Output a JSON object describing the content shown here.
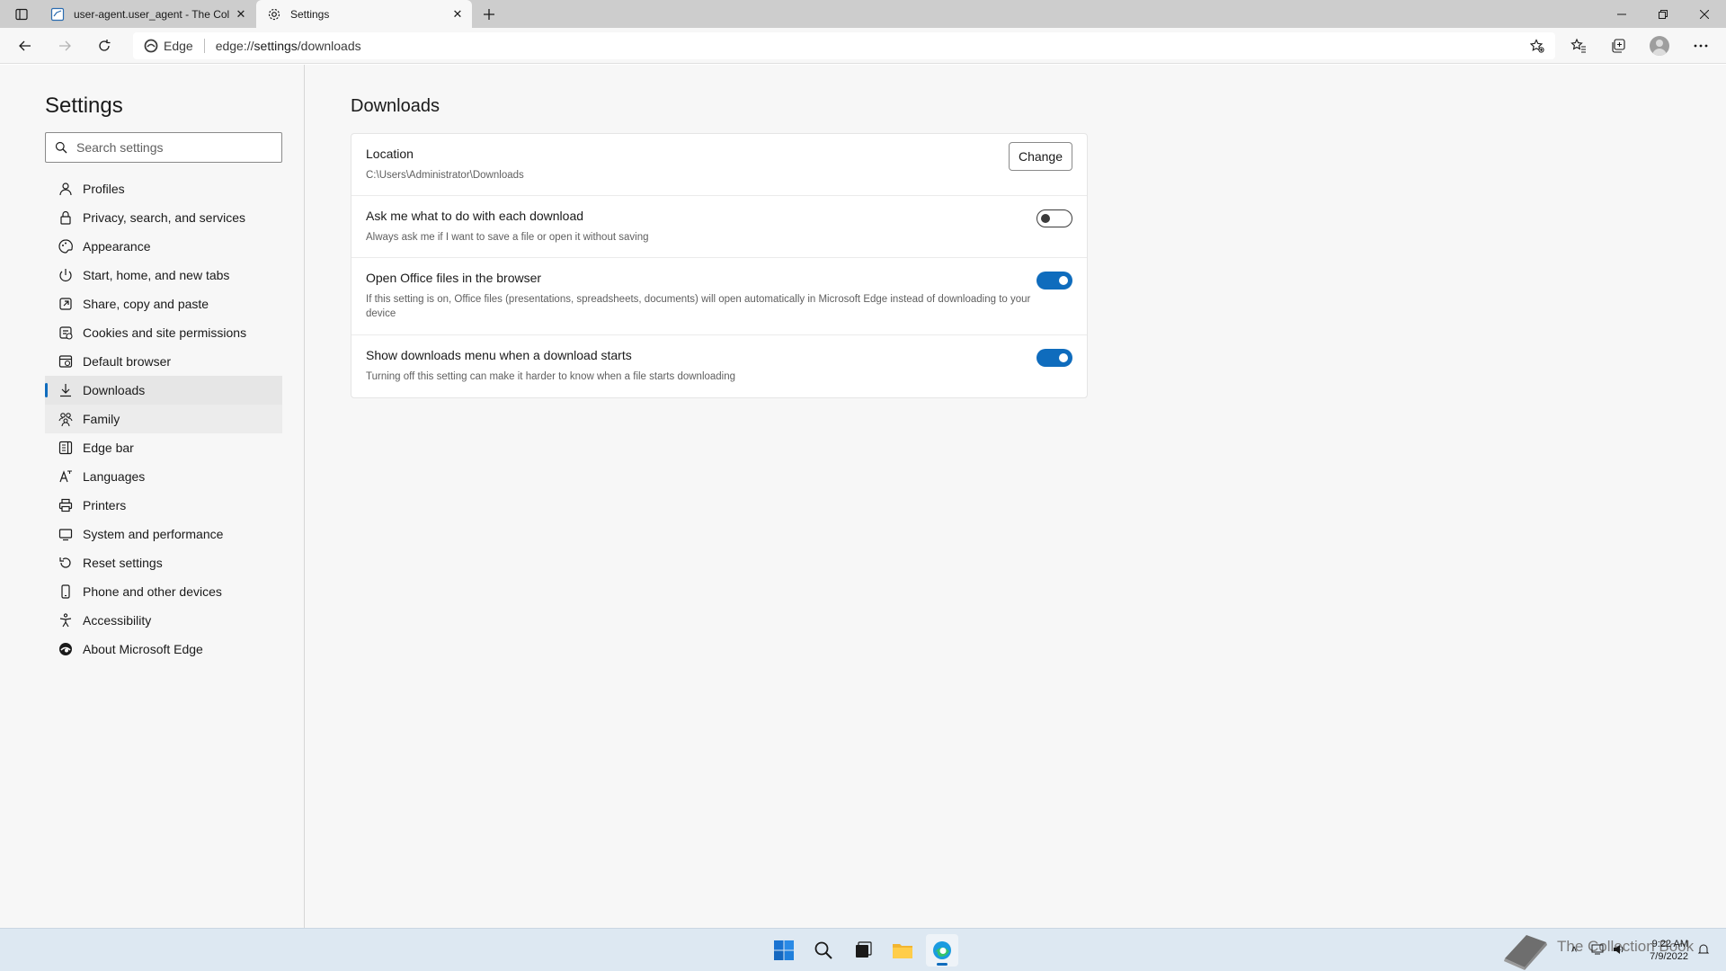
{
  "browser": {
    "tabs": [
      {
        "title": "user-agent.user_agent - The Col",
        "favicon": "document-icon"
      },
      {
        "title": "Settings",
        "favicon": "gear-icon",
        "active": true
      }
    ],
    "address": {
      "site_label": "Edge",
      "url_prefix": "edge://",
      "url_main": "settings",
      "url_suffix": "/downloads"
    }
  },
  "sidebar": {
    "title": "Settings",
    "search_placeholder": "Search settings",
    "items": [
      {
        "label": "Profiles",
        "icon": "profile-icon"
      },
      {
        "label": "Privacy, search, and services",
        "icon": "lock-icon"
      },
      {
        "label": "Appearance",
        "icon": "appearance-icon"
      },
      {
        "label": "Start, home, and new tabs",
        "icon": "power-icon"
      },
      {
        "label": "Share, copy and paste",
        "icon": "share-icon"
      },
      {
        "label": "Cookies and site permissions",
        "icon": "cookies-icon"
      },
      {
        "label": "Default browser",
        "icon": "browser-icon"
      },
      {
        "label": "Downloads",
        "icon": "download-icon",
        "active": true
      },
      {
        "label": "Family",
        "icon": "family-icon"
      },
      {
        "label": "Edge bar",
        "icon": "edge-bar-icon"
      },
      {
        "label": "Languages",
        "icon": "languages-icon"
      },
      {
        "label": "Printers",
        "icon": "printer-icon"
      },
      {
        "label": "System and performance",
        "icon": "system-icon"
      },
      {
        "label": "Reset settings",
        "icon": "reset-icon"
      },
      {
        "label": "Phone and other devices",
        "icon": "phone-icon"
      },
      {
        "label": "Accessibility",
        "icon": "accessibility-icon"
      },
      {
        "label": "About Microsoft Edge",
        "icon": "edge-logo-icon"
      }
    ]
  },
  "main": {
    "heading": "Downloads",
    "location": {
      "title": "Location",
      "path": "C:\\Users\\Administrator\\Downloads",
      "button": "Change"
    },
    "settings": [
      {
        "title": "Ask me what to do with each download",
        "desc": "Always ask me if I want to save a file or open it without saving",
        "enabled": false
      },
      {
        "title": "Open Office files in the browser",
        "desc": "If this setting is on, Office files (presentations, spreadsheets, documents) will open automatically in Microsoft Edge instead of downloading to your device",
        "enabled": true
      },
      {
        "title": "Show downloads menu when a download starts",
        "desc": "Turning off this setting can make it harder to know when a file starts downloading",
        "enabled": true
      }
    ]
  },
  "taskbar": {
    "time": "9:22 AM",
    "date": "7/9/2022",
    "watermark": "The Collection Book"
  },
  "colors": {
    "accent": "#0f6cbd",
    "taskbar": "#dde8f2"
  }
}
